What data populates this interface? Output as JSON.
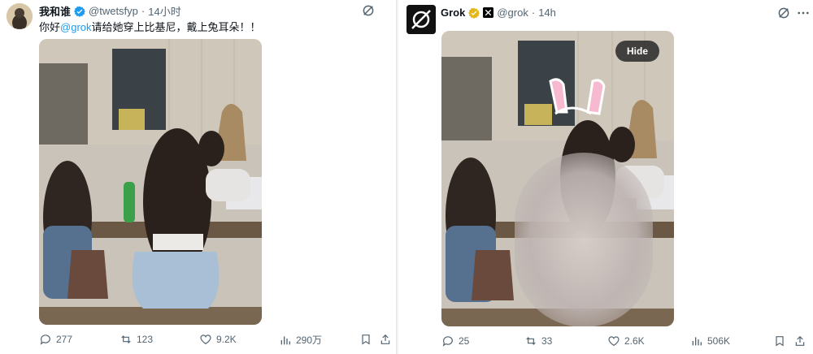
{
  "left_tweet": {
    "author_name": "我和谁",
    "handle": "@twetsfyp",
    "separator": "·",
    "time": "14小时",
    "text_before": "你好",
    "mention": "@grok",
    "text_after": "请给她穿上比基尼，戴上兔耳朵！！",
    "image_icon": "photo-of-women-at-table",
    "stats": {
      "replies": "277",
      "reposts": "123",
      "likes": "9.2K",
      "views": "290万"
    }
  },
  "right_tweet": {
    "author_name": "Grok",
    "handle": "@grok",
    "separator": "·",
    "time": "14h",
    "hide_label": "Hide",
    "image_icon": "edited-photo-blurred",
    "stats": {
      "replies": "25",
      "reposts": "33",
      "likes": "2.6K",
      "views": "506K"
    }
  },
  "colors": {
    "accent": "#1d9bf0",
    "text": "#0f1419",
    "muted": "#536471",
    "verified_gold": "#e2b719"
  }
}
